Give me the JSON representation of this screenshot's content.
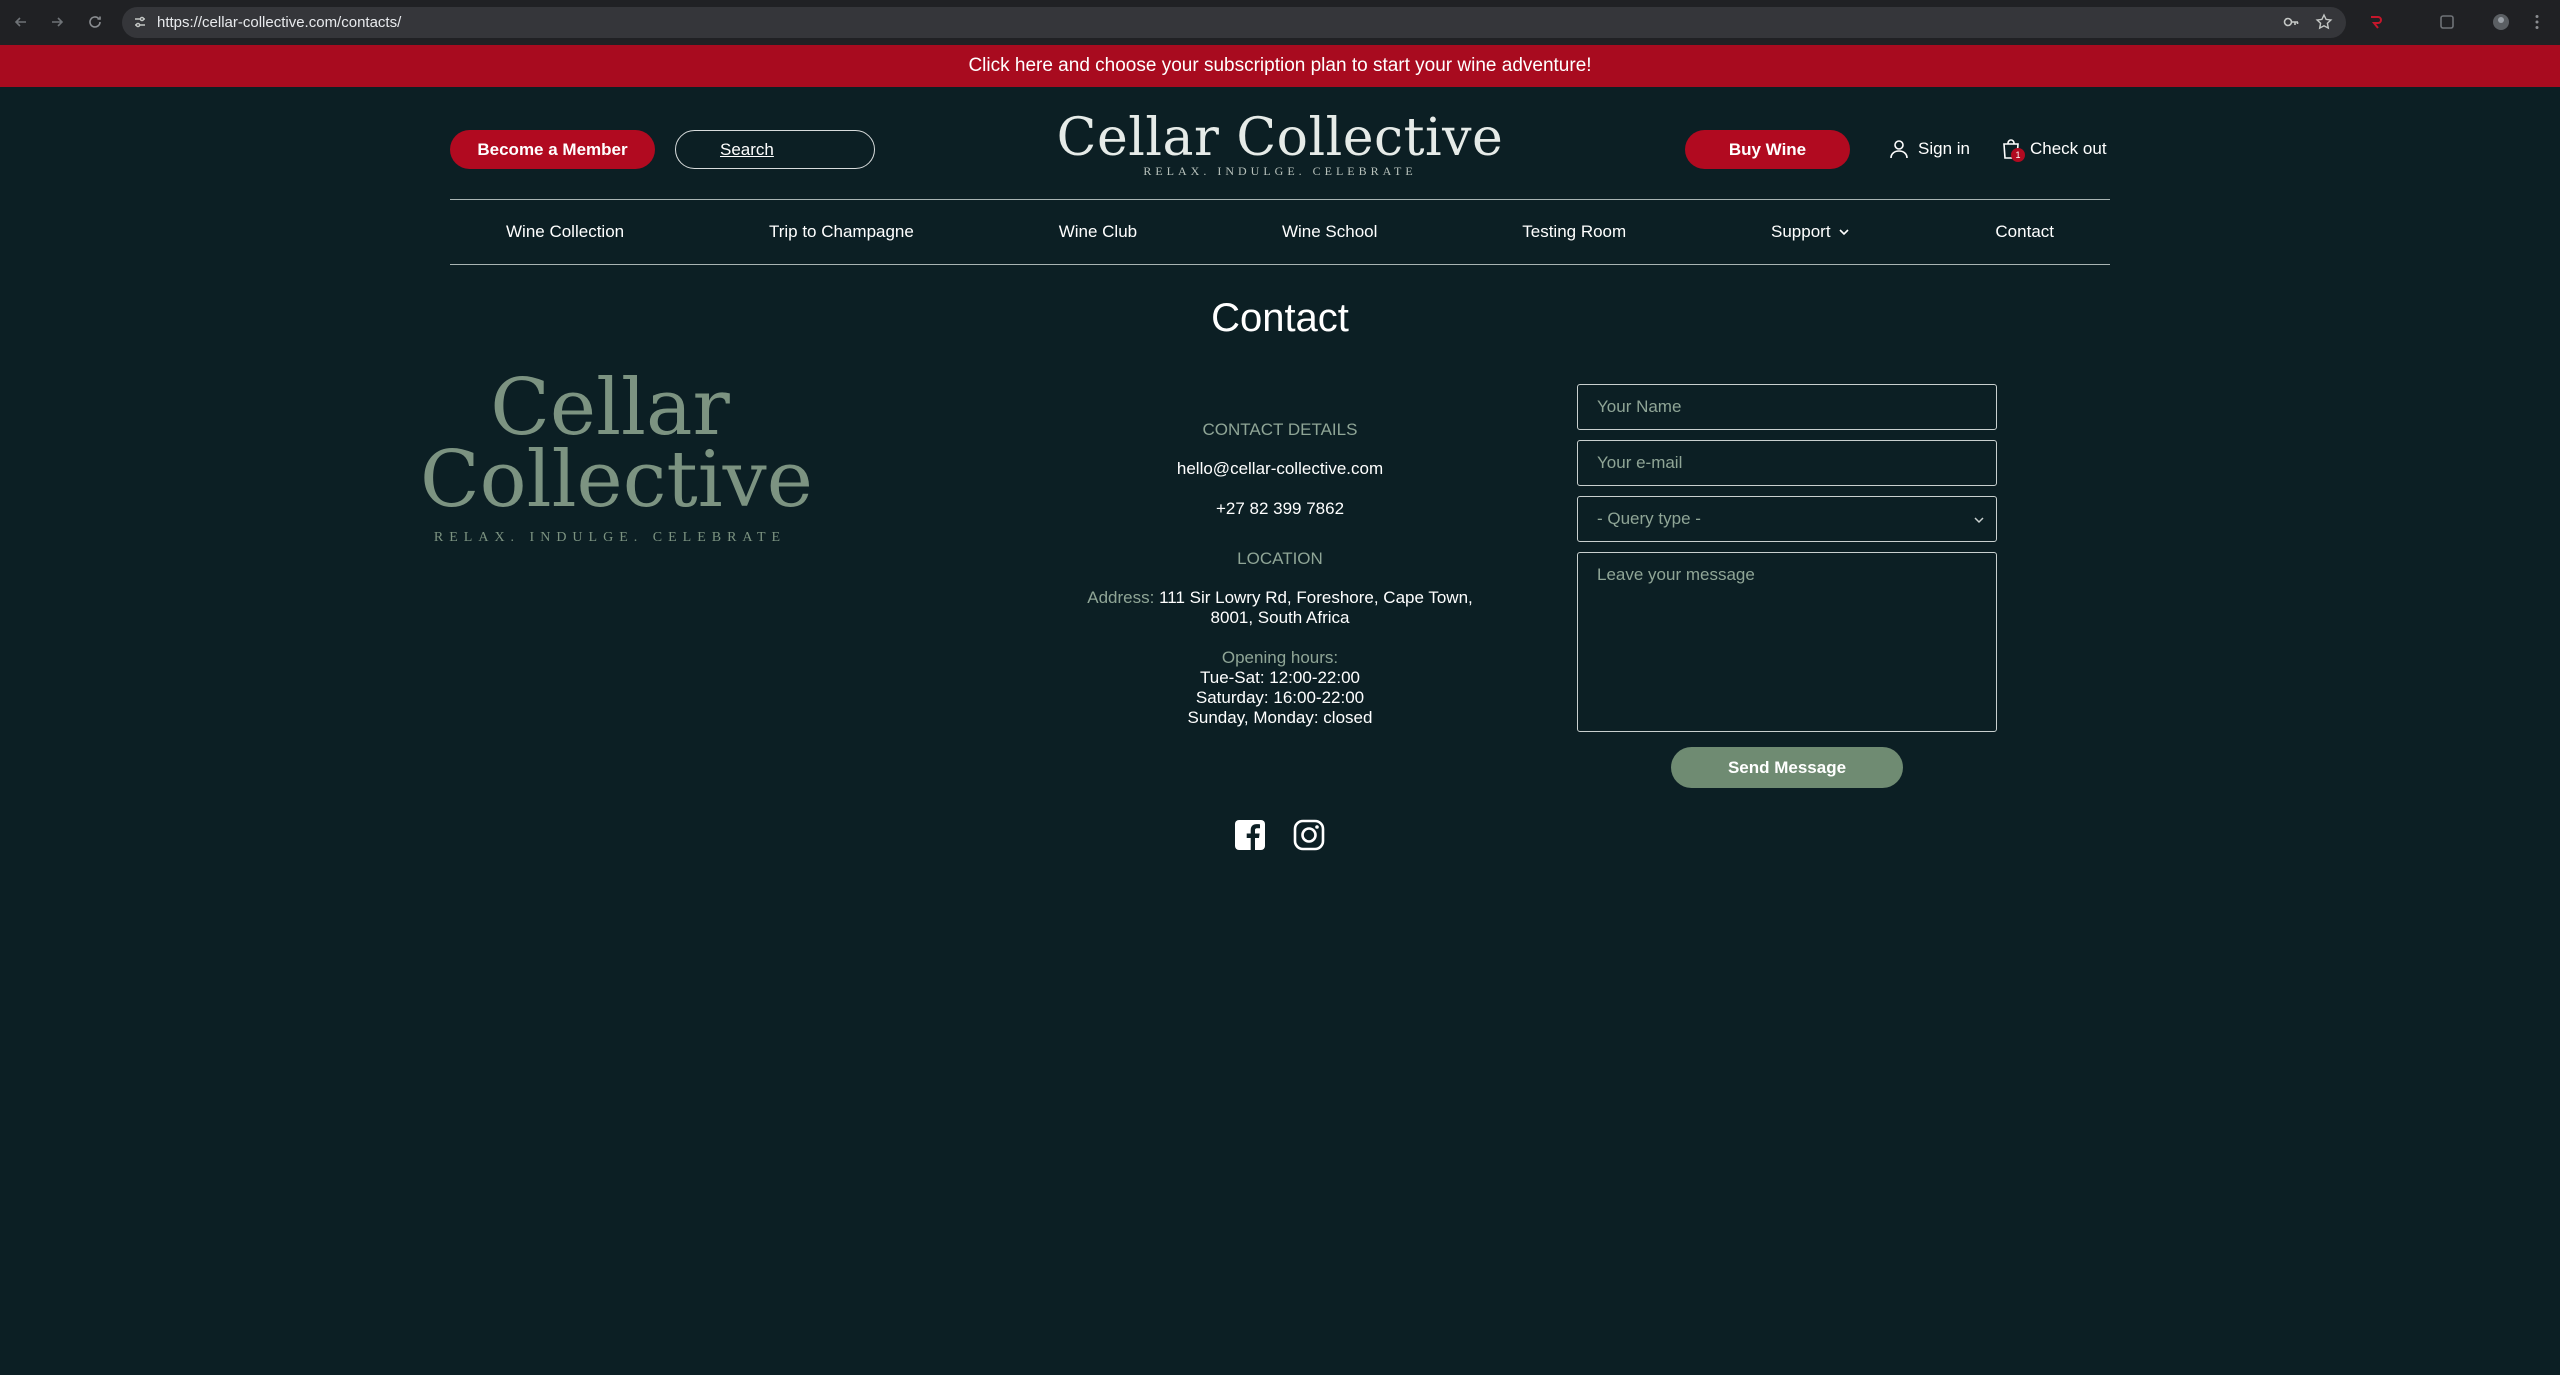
{
  "browser": {
    "url": "https://cellar-collective.com/contacts/"
  },
  "announcement": "Click here and choose your subscription plan to start your wine adventure!",
  "header": {
    "become_member": "Become a Member",
    "search_label": "Search",
    "logo_title": "Cellar Collective",
    "logo_tagline": "RELAX. INDULGE. CELEBRATE",
    "buy_wine": "Buy Wine",
    "sign_in": "Sign in",
    "check_out": "Check out",
    "cart_count": "1"
  },
  "nav": {
    "items": [
      "Wine Collection",
      "Trip to Champagne",
      "Wine Club",
      "Wine School",
      "Testing Room",
      "Support",
      "Contact"
    ]
  },
  "page": {
    "title": "Contact",
    "big_logo_line1": "Cellar",
    "big_logo_line2": "Collective",
    "big_logo_tagline": "RELAX. INDULGE. CELEBRATE"
  },
  "contact": {
    "details_heading": "CONTACT DETAILS",
    "email": "hello@cellar-collective.com",
    "phone": "+27 82 399 7862",
    "location_heading": "LOCATION",
    "address_label": "Address:",
    "address_line1": "111 Sir Lowry Rd, Foreshore, Cape Town,",
    "address_line2": "8001, South Africa",
    "hours_label": "Opening hours:",
    "hours": [
      "Tue-Sat: 12:00-22:00",
      "Saturday: 16:00-22:00",
      "Sunday, Monday: closed"
    ]
  },
  "social": {
    "icons": [
      "facebook-icon",
      "instagram-icon"
    ]
  },
  "form": {
    "name_placeholder": "Your Name",
    "email_placeholder": "Your e-mail",
    "query_type": "- Query type -",
    "message_placeholder": "Leave your message",
    "send_label": "Send Message"
  },
  "colors": {
    "background": "#0c1f24",
    "brand_red": "#b10a20",
    "sage": "#6f8b72"
  }
}
